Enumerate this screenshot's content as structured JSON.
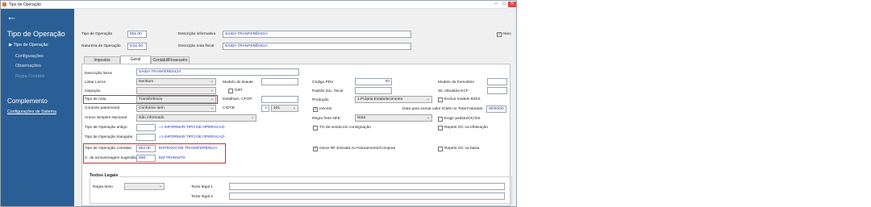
{
  "window": {
    "title": "Tipo de Operação"
  },
  "sidebar": {
    "heading": "Tipo de Operação",
    "items": [
      {
        "label": "Tipo de Operação",
        "active": true
      },
      {
        "label": "Configurações"
      },
      {
        "label": "Observações"
      },
      {
        "label": "Regra Contábil",
        "disabled": true
      }
    ],
    "section2": "Complemento",
    "link": "Configurações de Sistema"
  },
  "header": {
    "tipo_op_label": "Tipo de Operação",
    "tipo_op_value": "851.00",
    "natureza_label": "Natureza de Operação",
    "natureza_value": "8.51.00",
    "desc_info_label": "Descrição informativa",
    "desc_info_value": "SAIDA TRANFERÊNCIA",
    "desc_fiscal_label": "Descrição nota fiscal",
    "desc_fiscal_value": "SAIDA TRANFERÊNCIA",
    "ativo_label": "Ativo"
  },
  "tabs": [
    "Impostos",
    "Geral",
    "Contábil/Financeiro"
  ],
  "form": {
    "desc_livros_label": "Descrição livros",
    "desc_livros_value": "SAIDA TRANFERENCIA",
    "listar_livros_label": "Listar Livros",
    "listar_livros_value": "Nenhum",
    "inspecao_label": "Inspeção",
    "inspecao_value": "",
    "tipo_nota_label": "Tipo de nota",
    "tipo_nota_value": "Transferência",
    "controle_label": "Controle patrimonial",
    "controle_value": "Conforme Item",
    "anexo_label": "Anexo Simples Nacional",
    "anexo_value": "Não informado",
    "tipo_antigo_label": "Tipo de Operação antigo",
    "tipo_antigo_value": ".",
    "tipo_antigo_hint": "=> INFORMAR TIPO DE OPERACAO",
    "tipo_triang_label": "Tipo de Operação triangular",
    "tipo_triang_value": ".",
    "tipo_triang_hint": "=> INFORMAR TIPO DE OPERACAO",
    "tipo_corr_label": "Tipo de Operação correlato",
    "tipo_corr_value": "852.00",
    "tipo_corr_desc": "ENTRADA DE TRANSFERÊNCIA",
    "armaz_label": "C. de armazenagem sugestão",
    "armaz_value": "008",
    "armaz_desc": "EM TRANSITO",
    "modelo_leiaute_label": "Modelo do leiaute",
    "modelo_leiaute_value": "",
    "dipi_label": "DIPI",
    "detalham_label": "Detalham. CFOP",
    "detalham_value": "",
    "ciotb_label": "CIOTB",
    "ciotb_value": "1",
    "ciotb_sel": "101",
    "codigo_pdv_label": "Código PDV",
    "codigo_pdv_value": "00",
    "padrao_doc_label": "Padrão doc. fiscal",
    "padrao_doc_value": "",
    "producao_label": "Produção",
    "producao_value": "1.Própria Estabelecimento",
    "inscrito_label": "Inscrito",
    "data_somar_label": "Data para somar valor ICMS no Total Faturado",
    "data_somar_value": "00/00/00",
    "regra_frete_label": "Regra frete NFE",
    "regra_frete_value": "Nota",
    "to_venda_label": "TO de venda em consignação",
    "gerar_nf_label": "Gerar NF Entrada no Faturamento/Compras",
    "modelo_form_label": "Modelo de formulário",
    "modelo_form_value": "",
    "sit_trib_label": "Sit. tributária ECF",
    "sit_trib_value": "",
    "excluir_label": "Excluir modelo 8/ISS",
    "exigir_label": "Exigir pedido/OC/OS",
    "repetir_ef_label": "Repetir OC na efetivação",
    "repetir_baixa_label": "Repetir OC na baixa"
  },
  "textos": {
    "title": "Textos Legais",
    "regra_label": "Regra texto",
    "regra_value": "",
    "texto1_label": "Texto legal 1",
    "texto1_value": "",
    "texto2_label": "Texto legal 2",
    "texto2_value": ""
  }
}
